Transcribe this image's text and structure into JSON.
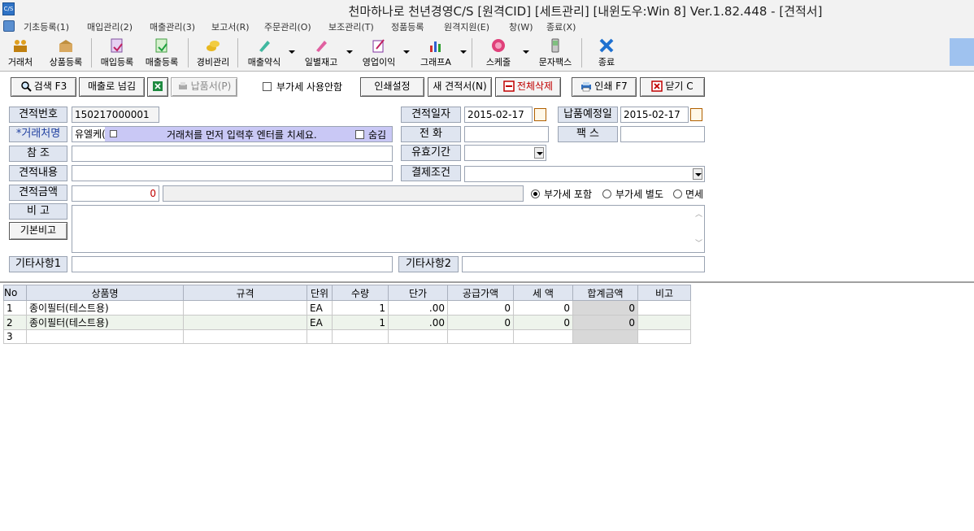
{
  "window": {
    "title": "천마하나로 천년경영C/S [원격CID] [세트관리] [내윈도우:Win 8] Ver.1.82.448 - [견적서]"
  },
  "menu": [
    "기초등록(1)",
    "매입관리(2)",
    "매출관리(3)",
    "보고서(R)",
    "주문관리(O)",
    "보조관리(T)",
    "정품등록",
    "원격지원(E)",
    "창(W)",
    "종료(X)"
  ],
  "toolbar": {
    "customer": "거래처",
    "product": "상품등록",
    "purchase": "매입등록",
    "sales": "매출등록",
    "expense": "경비관리",
    "sales_summary": "매출약식",
    "daily_stock": "일별재고",
    "profit": "영업이익",
    "graph": "그래프A",
    "schedule": "스케줄",
    "sms_fax": "문자팩스",
    "exit": "종료"
  },
  "actions": {
    "search": "검색 F3",
    "to_sales": "매출로 넘김",
    "delivery": "납품서(P)",
    "no_vat": "부가세 사용안함",
    "print_settings": "인쇄설정",
    "new_quote": "새 견적서(N)",
    "delete_all": "전체삭제",
    "print": "인쇄 F7",
    "close": "닫기 C"
  },
  "form": {
    "quote_no_label": "견적번호",
    "quote_no": "150217000001",
    "quote_date_label": "견적일자",
    "quote_date": "2015-02-17",
    "delivery_date_label": "납품예정일",
    "delivery_date": "2015-02-17",
    "customer_label": "*거래처명",
    "customer_value": "유엘케(",
    "customer_hint": "거래처를 먼저 입력후 엔터를 치세요.",
    "hide_label": "숨김",
    "phone_label": "전    화",
    "fax_label": "팩    스",
    "ref_label": "참    조",
    "validity_label": "유효기간",
    "content_label": "견적내용",
    "payment_label": "결제조건",
    "amount_label": "견적금액",
    "amount_value": "0",
    "vat_options": [
      "부가세 포함",
      "부가세 별도",
      "면세"
    ],
    "vat_selected": "부가세 포함",
    "note_label": "비    고",
    "basic_note_btn": "기본비고",
    "etc1_label": "기타사항1",
    "etc2_label": "기타사항2"
  },
  "table": {
    "headers": [
      "No",
      "상품명",
      "규격",
      "단위",
      "수량",
      "단가",
      "공급가액",
      "세 액",
      "합계금액",
      "비고"
    ],
    "rows": [
      [
        "1",
        "종이필터(테스트용)",
        "",
        "EA",
        "1",
        ".00",
        "0",
        "0",
        "0",
        ""
      ],
      [
        "2",
        "종이필터(테스트용)",
        "",
        "EA",
        "1",
        ".00",
        "0",
        "0",
        "0",
        ""
      ],
      [
        "3",
        "",
        "",
        "",
        "",
        "",
        "",
        "",
        "",
        ""
      ]
    ]
  }
}
